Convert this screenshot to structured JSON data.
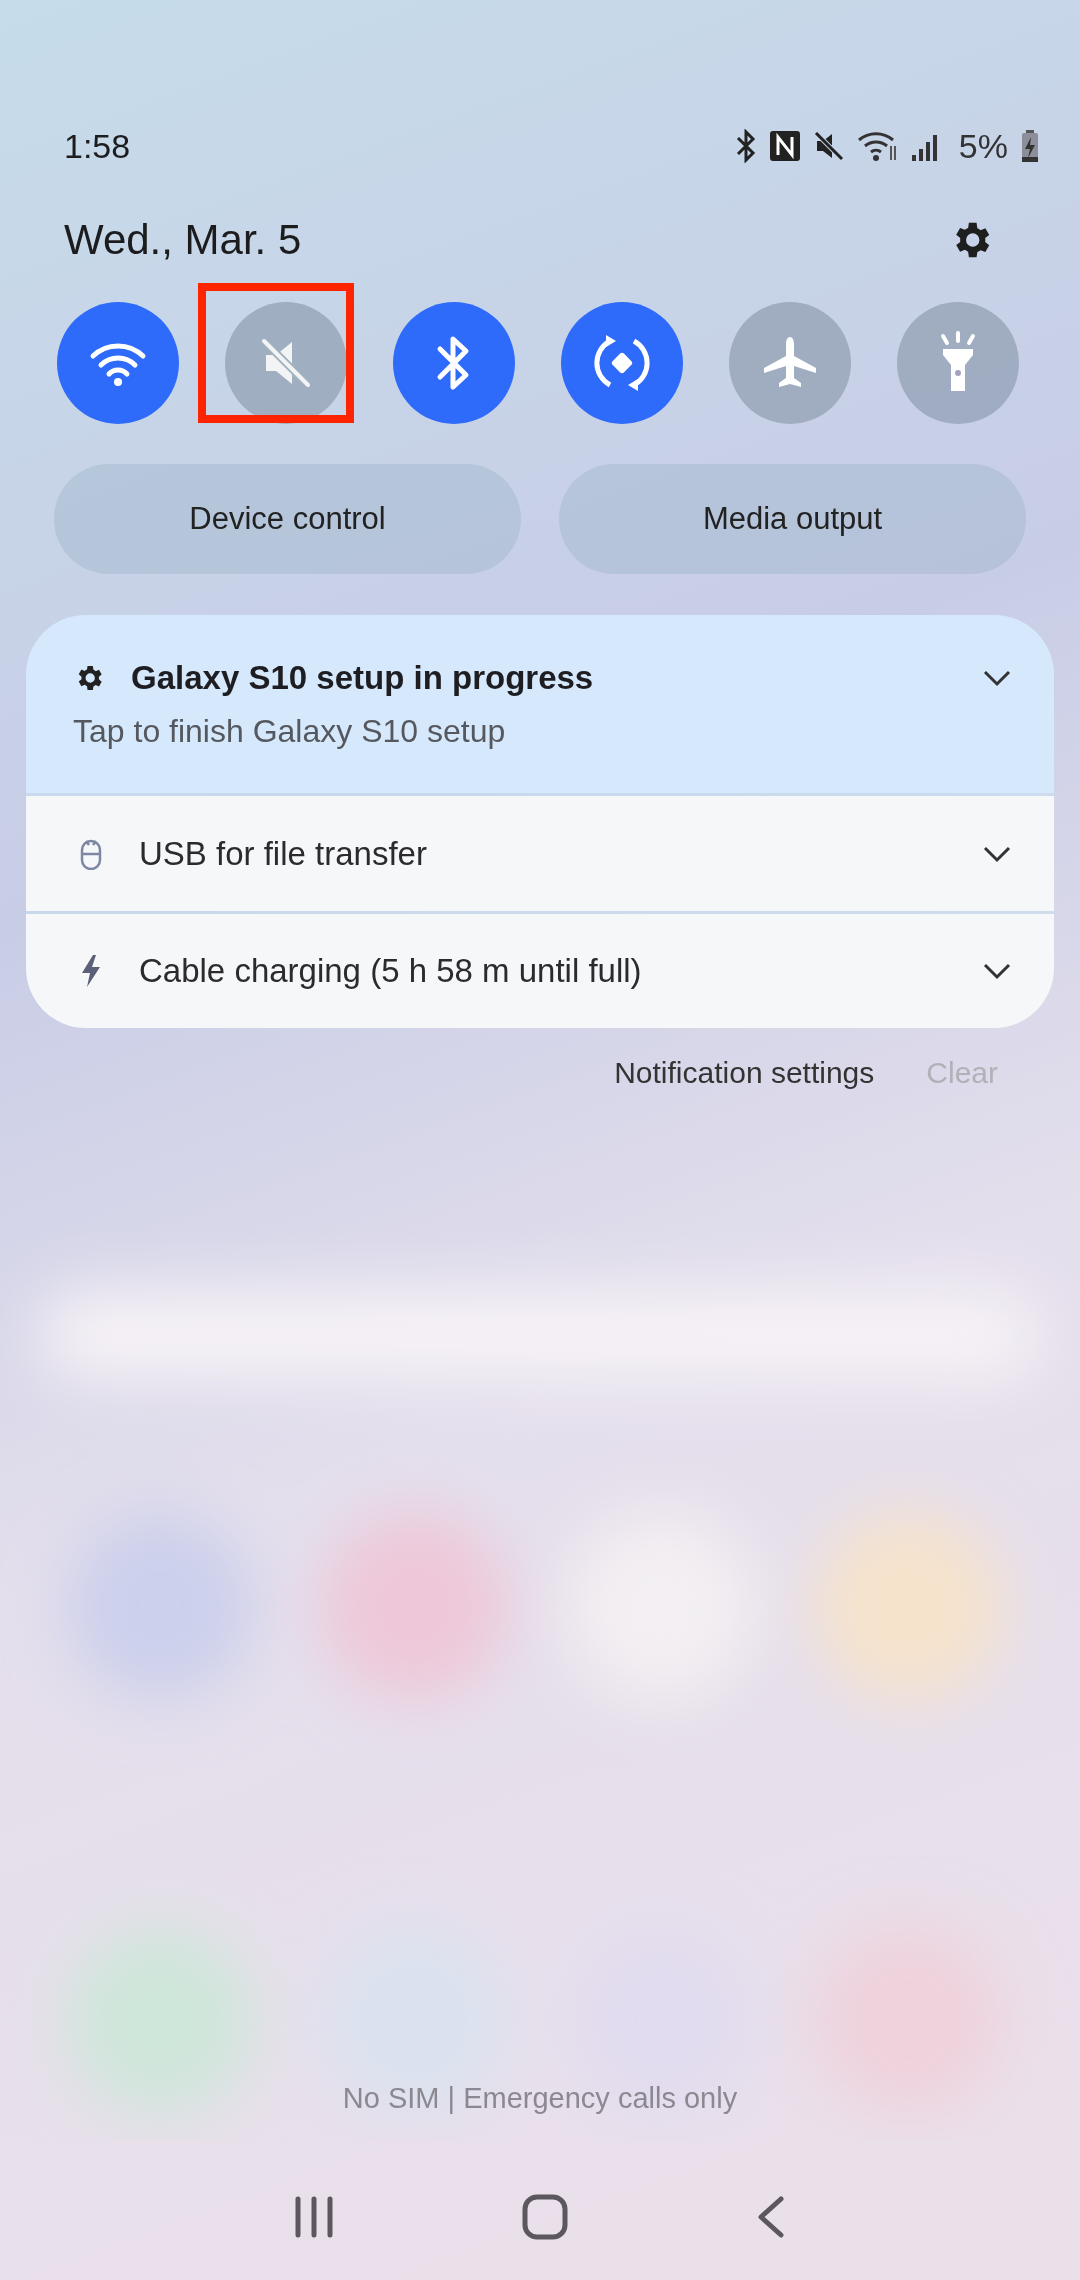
{
  "status_bar": {
    "time": "1:58",
    "battery_text": "5%"
  },
  "date": "Wed., Mar. 5",
  "quick_toggles": [
    {
      "kind": "wifi",
      "on": true,
      "highlighted": false
    },
    {
      "kind": "mute",
      "on": false,
      "highlighted": true
    },
    {
      "kind": "bluetooth",
      "on": true,
      "highlighted": false
    },
    {
      "kind": "rotate",
      "on": true,
      "highlighted": false
    },
    {
      "kind": "airplane",
      "on": false,
      "highlighted": false
    },
    {
      "kind": "flashlight",
      "on": false,
      "highlighted": false
    }
  ],
  "buttons": [
    "Device control",
    "Media output"
  ],
  "notifications": [
    {
      "kind": "setup",
      "title": "Galaxy S10 setup in progress",
      "text": "Tap to finish Galaxy S10 setup"
    },
    {
      "kind": "usb",
      "title": "USB for file transfer"
    },
    {
      "kind": "charging",
      "title": "Cable charging (5 h 58 m until full)"
    }
  ],
  "notification_actions": {
    "settings": "Notification settings",
    "clear": "Clear",
    "clear_disabled": true
  },
  "carrier_text": "No SIM | Emergency calls only"
}
